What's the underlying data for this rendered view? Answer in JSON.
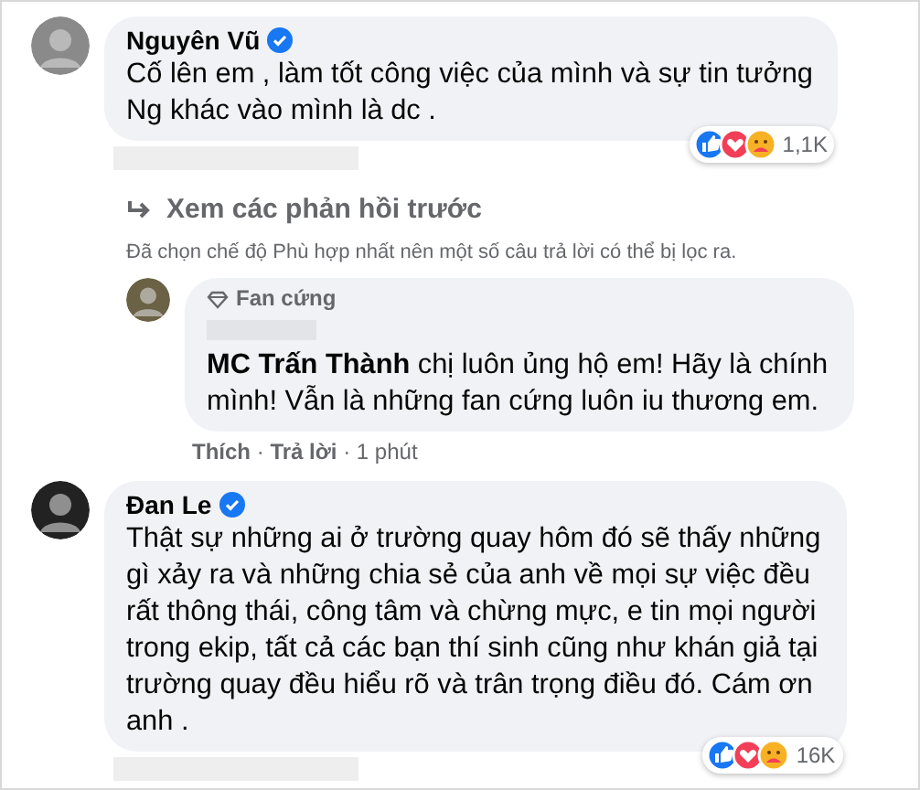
{
  "comments": [
    {
      "author": "Nguyên Vũ",
      "verified": true,
      "lines": [
        "Cố lên em , làm tốt công việc của mình và sự tin tưởng",
        "Ng khác vào mình là dc ."
      ],
      "reaction_count": "1,1K"
    },
    {
      "author": "Đan Le",
      "verified": true,
      "lines": [
        "Thật sự những ai ở trường quay hôm đó sẽ thấy những",
        "gì xảy ra và những chia sẻ của anh về mọi sự việc đều",
        "rất thông thái, công tâm và chừng mực, e tin mọi người",
        "trong ekip, tất cả các bạn thí sinh cũng như khán giả tại",
        "trường quay đều hiểu rõ và trân trọng điều đó. Cám ơn",
        "anh ."
      ],
      "reaction_count": "16K"
    }
  ],
  "replies": {
    "view_previous": "Xem các phản hồi trước",
    "filter_note": "Đã chọn chế độ Phù hợp nhất nên một số câu trả lời có thể bị lọc ra.",
    "reply": {
      "badge": "Fan cứng",
      "lines": [
        "**MC Trấn Thành** chị luôn ủng hộ em! Hãy là chính",
        "mình! Vẫn là những fan cứng luôn iu thương em."
      ],
      "actions": [
        "Thích",
        "Trả lời"
      ],
      "separator": "·",
      "time": "1 phút"
    }
  }
}
